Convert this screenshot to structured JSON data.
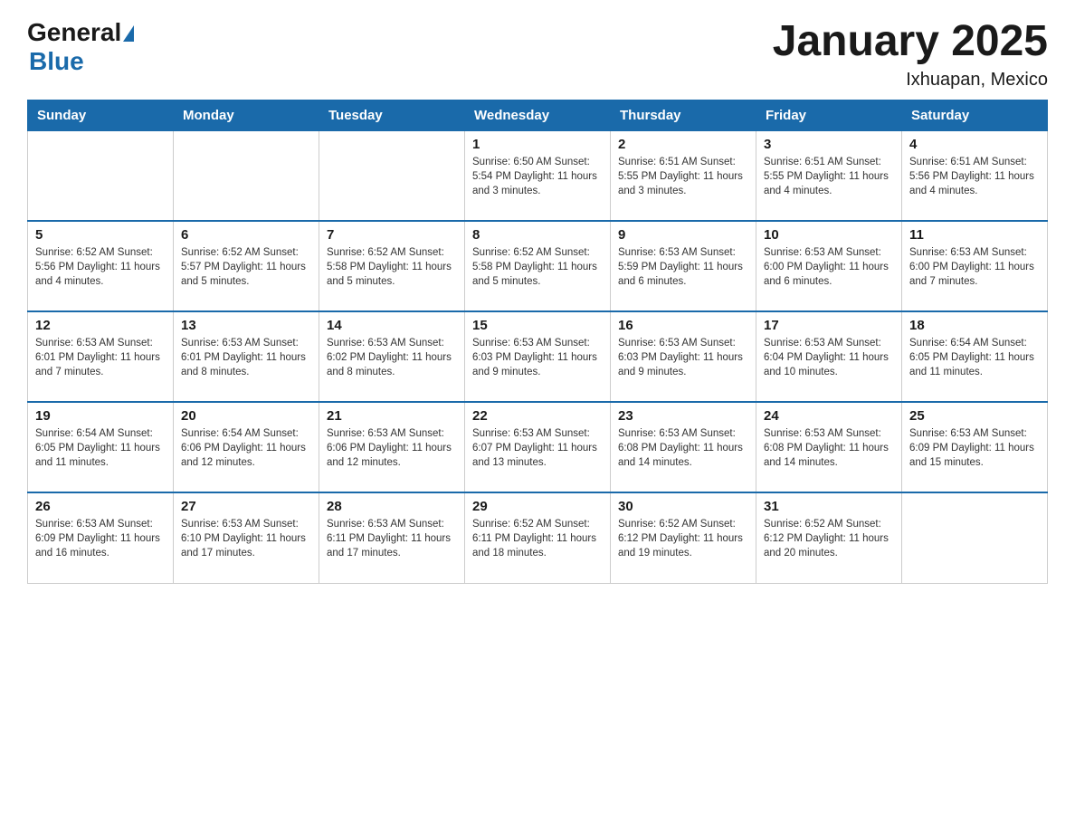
{
  "logo": {
    "general": "General",
    "blue": "Blue",
    "tagline": "GeneralBlue"
  },
  "title": "January 2025",
  "location": "Ixhuapan, Mexico",
  "days_of_week": [
    "Sunday",
    "Monday",
    "Tuesday",
    "Wednesday",
    "Thursday",
    "Friday",
    "Saturday"
  ],
  "weeks": [
    [
      {
        "day": "",
        "info": ""
      },
      {
        "day": "",
        "info": ""
      },
      {
        "day": "",
        "info": ""
      },
      {
        "day": "1",
        "info": "Sunrise: 6:50 AM\nSunset: 5:54 PM\nDaylight: 11 hours and 3 minutes."
      },
      {
        "day": "2",
        "info": "Sunrise: 6:51 AM\nSunset: 5:55 PM\nDaylight: 11 hours and 3 minutes."
      },
      {
        "day": "3",
        "info": "Sunrise: 6:51 AM\nSunset: 5:55 PM\nDaylight: 11 hours and 4 minutes."
      },
      {
        "day": "4",
        "info": "Sunrise: 6:51 AM\nSunset: 5:56 PM\nDaylight: 11 hours and 4 minutes."
      }
    ],
    [
      {
        "day": "5",
        "info": "Sunrise: 6:52 AM\nSunset: 5:56 PM\nDaylight: 11 hours and 4 minutes."
      },
      {
        "day": "6",
        "info": "Sunrise: 6:52 AM\nSunset: 5:57 PM\nDaylight: 11 hours and 5 minutes."
      },
      {
        "day": "7",
        "info": "Sunrise: 6:52 AM\nSunset: 5:58 PM\nDaylight: 11 hours and 5 minutes."
      },
      {
        "day": "8",
        "info": "Sunrise: 6:52 AM\nSunset: 5:58 PM\nDaylight: 11 hours and 5 minutes."
      },
      {
        "day": "9",
        "info": "Sunrise: 6:53 AM\nSunset: 5:59 PM\nDaylight: 11 hours and 6 minutes."
      },
      {
        "day": "10",
        "info": "Sunrise: 6:53 AM\nSunset: 6:00 PM\nDaylight: 11 hours and 6 minutes."
      },
      {
        "day": "11",
        "info": "Sunrise: 6:53 AM\nSunset: 6:00 PM\nDaylight: 11 hours and 7 minutes."
      }
    ],
    [
      {
        "day": "12",
        "info": "Sunrise: 6:53 AM\nSunset: 6:01 PM\nDaylight: 11 hours and 7 minutes."
      },
      {
        "day": "13",
        "info": "Sunrise: 6:53 AM\nSunset: 6:01 PM\nDaylight: 11 hours and 8 minutes."
      },
      {
        "day": "14",
        "info": "Sunrise: 6:53 AM\nSunset: 6:02 PM\nDaylight: 11 hours and 8 minutes."
      },
      {
        "day": "15",
        "info": "Sunrise: 6:53 AM\nSunset: 6:03 PM\nDaylight: 11 hours and 9 minutes."
      },
      {
        "day": "16",
        "info": "Sunrise: 6:53 AM\nSunset: 6:03 PM\nDaylight: 11 hours and 9 minutes."
      },
      {
        "day": "17",
        "info": "Sunrise: 6:53 AM\nSunset: 6:04 PM\nDaylight: 11 hours and 10 minutes."
      },
      {
        "day": "18",
        "info": "Sunrise: 6:54 AM\nSunset: 6:05 PM\nDaylight: 11 hours and 11 minutes."
      }
    ],
    [
      {
        "day": "19",
        "info": "Sunrise: 6:54 AM\nSunset: 6:05 PM\nDaylight: 11 hours and 11 minutes."
      },
      {
        "day": "20",
        "info": "Sunrise: 6:54 AM\nSunset: 6:06 PM\nDaylight: 11 hours and 12 minutes."
      },
      {
        "day": "21",
        "info": "Sunrise: 6:53 AM\nSunset: 6:06 PM\nDaylight: 11 hours and 12 minutes."
      },
      {
        "day": "22",
        "info": "Sunrise: 6:53 AM\nSunset: 6:07 PM\nDaylight: 11 hours and 13 minutes."
      },
      {
        "day": "23",
        "info": "Sunrise: 6:53 AM\nSunset: 6:08 PM\nDaylight: 11 hours and 14 minutes."
      },
      {
        "day": "24",
        "info": "Sunrise: 6:53 AM\nSunset: 6:08 PM\nDaylight: 11 hours and 14 minutes."
      },
      {
        "day": "25",
        "info": "Sunrise: 6:53 AM\nSunset: 6:09 PM\nDaylight: 11 hours and 15 minutes."
      }
    ],
    [
      {
        "day": "26",
        "info": "Sunrise: 6:53 AM\nSunset: 6:09 PM\nDaylight: 11 hours and 16 minutes."
      },
      {
        "day": "27",
        "info": "Sunrise: 6:53 AM\nSunset: 6:10 PM\nDaylight: 11 hours and 17 minutes."
      },
      {
        "day": "28",
        "info": "Sunrise: 6:53 AM\nSunset: 6:11 PM\nDaylight: 11 hours and 17 minutes."
      },
      {
        "day": "29",
        "info": "Sunrise: 6:52 AM\nSunset: 6:11 PM\nDaylight: 11 hours and 18 minutes."
      },
      {
        "day": "30",
        "info": "Sunrise: 6:52 AM\nSunset: 6:12 PM\nDaylight: 11 hours and 19 minutes."
      },
      {
        "day": "31",
        "info": "Sunrise: 6:52 AM\nSunset: 6:12 PM\nDaylight: 11 hours and 20 minutes."
      },
      {
        "day": "",
        "info": ""
      }
    ]
  ]
}
